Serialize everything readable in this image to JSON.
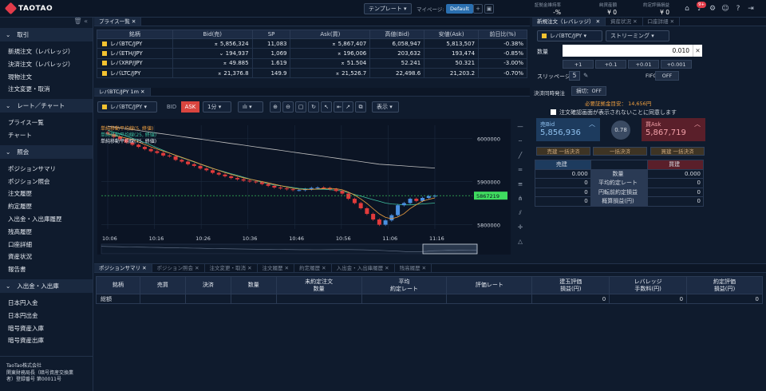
{
  "app": {
    "logo": "TAOTAO"
  },
  "topbar": {
    "template_label": "テンプレート",
    "mypage_label": "マイページ:",
    "mypage_value": "Default",
    "stats": [
      {
        "key": "証拠金維持率",
        "value": "-%"
      },
      {
        "key": "純資産額",
        "value": "¥ 0"
      },
      {
        "key": "約定評価損益",
        "value": "¥ 0"
      }
    ],
    "notif_count": "9+"
  },
  "sidebar": {
    "sections": [
      {
        "title": "取引",
        "items": [
          "新規注文（レバレッジ）",
          "決済注文（レバレッジ）",
          "現物注文",
          "注文変更・取消"
        ]
      },
      {
        "title": "レート／チャート",
        "items": [
          "プライス一覧",
          "チャート"
        ]
      },
      {
        "title": "照会",
        "items": [
          "ポジションサマリ",
          "ポジション照会",
          "注文履歴",
          "約定履歴",
          "入出金・入出庫履歴",
          "残高履歴",
          "口座詳細",
          "資産状況",
          "報告書"
        ]
      },
      {
        "title": "入出金・入出庫",
        "items": [
          "日本円入金",
          "日本円出金",
          "暗号資産入庫",
          "暗号資産出庫"
        ]
      }
    ],
    "footer": [
      "TaoTao株式会社",
      "関東財務局長（暗号資産交換業",
      "者）登録番号 第00011号"
    ]
  },
  "price_panel": {
    "tab": "プライス一覧",
    "headers": [
      "銘柄",
      "Bid(売)",
      "SP",
      "Ask(買)",
      "高値(Bid)",
      "安値(Ask)",
      "前日比(%)"
    ],
    "rows": [
      {
        "symbol": "レバBTC/JPY",
        "bid": "5,856,324",
        "bid_dir": "down",
        "sp": "11,083",
        "ask": "5,867,407",
        "ask_dir": "down",
        "high": "6,058,947",
        "low": "5,813,507",
        "change": "-0.38%"
      },
      {
        "symbol": "レバETH/JPY",
        "bid": "194,937",
        "bid_dir": "up",
        "sp": "1,069",
        "ask": "196,006",
        "ask_dir": "down",
        "high": "203,632",
        "low": "193,474",
        "change": "-0.85%"
      },
      {
        "symbol": "レバXRP/JPY",
        "bid": "49.885",
        "bid_dir": "down",
        "sp": "1.619",
        "ask": "51.504",
        "ask_dir": "down",
        "high": "52.241",
        "low": "50.321",
        "change": "-3.00%"
      },
      {
        "symbol": "レバLTC/JPY",
        "bid": "21,376.8",
        "bid_dir": "down",
        "sp": "149.9",
        "ask": "21,526.7",
        "ask_dir": "down",
        "high": "22,498.6",
        "low": "21,203.2",
        "change": "-0.70%"
      }
    ]
  },
  "chart_panel": {
    "tab": "レバBTC/JPY 1m",
    "symbol": "レバBTC/JPY",
    "bid_label": "BID",
    "ask_label": "ASK",
    "interval": "1分",
    "display_label": "表示",
    "legend": [
      "単純移動平均線(5, 終値)",
      "単純移動平均線(25, 終値)",
      "単純移動平均線(75, 終値)"
    ],
    "colors": {
      "up": "#4a90e2",
      "down": "#e23b3b",
      "ma5": "#f0a040",
      "ma25": "#3fbf9f",
      "ma75": "#bfbfbf",
      "current": "#3fdc5f"
    }
  },
  "chart_data": {
    "type": "candlestick",
    "x_ticks": [
      "10:06",
      "10:16",
      "10:26",
      "10:36",
      "10:46",
      "10:56",
      "11:06",
      "11:16"
    ],
    "y_ticks": [
      "6000000",
      "5900000",
      "5800000"
    ],
    "ylim": [
      5790000,
      6030000
    ],
    "current_price": "5867219",
    "close_series": [
      6010000,
      6003000,
      5998000,
      5990000,
      5985000,
      5980000,
      5975000,
      5970000,
      5966000,
      5960000,
      5958000,
      5950000,
      5946000,
      5940000,
      5936000,
      5930000,
      5926000,
      5920000,
      5916000,
      5912000,
      5908000,
      5905000,
      5902000,
      5900000,
      5898000,
      5894000,
      5890000,
      5886000,
      5884000,
      5882000,
      5880000,
      5880000,
      5882000,
      5885000,
      5886000,
      5885000,
      5882000,
      5878000,
      5872000,
      5860000,
      5850000,
      5838000,
      5825000,
      5812000,
      5800000,
      5810000,
      5822000,
      5845000,
      5850000,
      5860000,
      5855000,
      5862000,
      5866000,
      5867000
    ],
    "ma75_series": [
      6028000,
      6026000,
      6024000,
      6022000,
      6020000,
      6018000,
      6016000,
      6014000,
      6012000,
      6010000,
      6008000,
      6006000,
      6004000,
      6002000,
      6000000,
      5998000,
      5996000,
      5994000,
      5992000,
      5990000,
      5988000,
      5986000,
      5984000,
      5982000,
      5980000,
      5978000,
      5976000,
      5974000,
      5972000,
      5970000,
      5968000,
      5966000,
      5964000,
      5962000,
      5960000,
      5958000,
      5956000,
      5954000,
      5952000,
      5950000,
      5948000,
      5946000,
      5944000,
      5942000,
      5940000,
      5939000,
      5938000,
      5937000,
      5936000,
      5935000,
      5934000,
      5933000,
      5932000,
      5931000
    ],
    "ma25_series": [
      6018000,
      6014000,
      6010000,
      6005000,
      6000000,
      5995000,
      5990000,
      5984000,
      5978000,
      5972000,
      5966000,
      5960000,
      5955000,
      5950000,
      5945000,
      5940000,
      5935000,
      5930000,
      5926000,
      5922000,
      5918000,
      5914000,
      5910000,
      5906000,
      5902000,
      5898000,
      5895000,
      5892000,
      5890000,
      5888000,
      5886000,
      5884000,
      5883000,
      5882000,
      5882000,
      5882000,
      5881000,
      5880000,
      5878000,
      5874000,
      5870000,
      5866000,
      5862000,
      5858000,
      5854000,
      5850000,
      5848000,
      5847000,
      5846000,
      5846000,
      5847000,
      5848000,
      5849000,
      5850000
    ]
  },
  "order_panel": {
    "tabs": [
      "新規注文（レバレッジ）",
      "資産状況",
      "口座詳細"
    ],
    "symbol": "レバBTC/JPY",
    "mode": "ストリーミング",
    "qty_label": "数量",
    "qty_value": "0.010",
    "increments": [
      "+1",
      "+0.1",
      "+0.01",
      "+0.001"
    ],
    "slippage_label": "スリッページ",
    "slippage_value": "5",
    "fifo_label": "FIFO",
    "fifo_value": "OFF",
    "settle_label": "決済同時発注",
    "settle_value": "損切：OFF",
    "margin_label": "必要証拠金目安：",
    "margin_value": "14,656円",
    "confirm_label": "注文確認画面が表示されないことに同意します",
    "sell_label": "売Bid",
    "sell_price": "5,856,936",
    "spread": "0.78",
    "buy_label": "買Ask",
    "buy_price": "5,867,719",
    "batch_buttons": [
      "売建 一括決済",
      "一括決済",
      "買建 一括決済"
    ],
    "pos_headers": {
      "sell": "売建",
      "mid": "",
      "buy": "買建"
    },
    "pos_rows": [
      {
        "label": "数量",
        "sell": "0.000",
        "buy": "0.000"
      },
      {
        "label": "平均約定レート",
        "sell": "0",
        "buy": "0"
      },
      {
        "label": "円転前約定損益",
        "sell": "0",
        "buy": "0"
      },
      {
        "label": "概算損益(円)",
        "sell": "0",
        "buy": "0"
      }
    ]
  },
  "bottom_panel": {
    "tabs": [
      "ポジションサマリ",
      "ポジション照会",
      "注文変更・取消",
      "注文履歴",
      "約定履歴",
      "入出金・入出庫履歴",
      "残高履歴"
    ],
    "headers": [
      "銘柄",
      "売買",
      "決済",
      "数量",
      "未約定注文\n数量",
      "平均\n約定レート",
      "評価レート",
      "建玉評価\n損益(円)",
      "レバレッジ\n手数料(円)",
      "約定評価\n損益(円)"
    ],
    "total_row": {
      "label": "総額",
      "pnl": "0",
      "fee": "0",
      "exec_pnl": "0"
    }
  }
}
